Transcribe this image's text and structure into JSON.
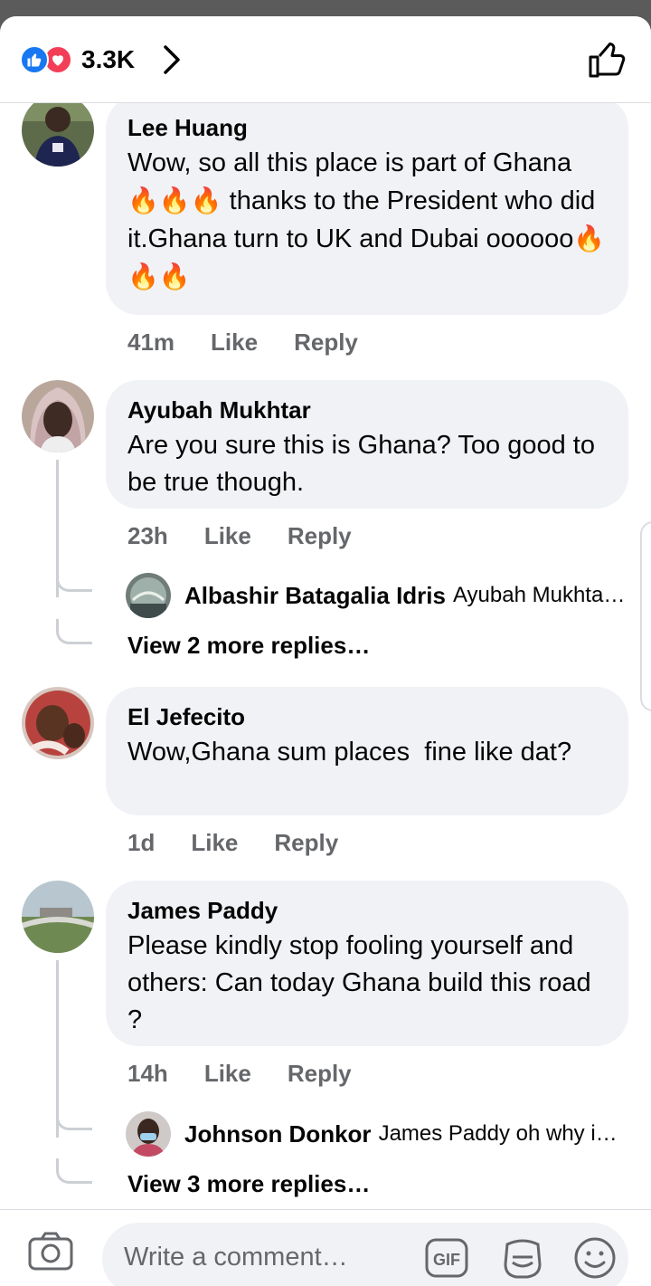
{
  "header": {
    "reaction_count": "3.3K"
  },
  "comments": [
    {
      "author": "Lee Huang",
      "text_before": "Wow, so all this place is part of Ghana ",
      "text_mid": " thanks to the President who did it.Ghana turn to UK and Dubai oooooo",
      "fire": "🔥🔥🔥",
      "time": "41m",
      "like": "Like",
      "reply": "Reply"
    },
    {
      "author": "Ayubah Mukhtar",
      "text": "Are you sure this is Ghana? Too good to be true though.",
      "time": "23h",
      "like": "Like",
      "reply": "Reply",
      "reply_preview": {
        "author": "Albashir Batagalia Idris",
        "snippet": "Ayubah Mukhtar…"
      },
      "view_more": "View 2 more replies…"
    },
    {
      "author": "El Jefecito",
      "text": "Wow,Ghana sum places  fine like dat?",
      "time": "1d",
      "like": "Like",
      "reply": "Reply"
    },
    {
      "author": "James Paddy",
      "text": "Please kindly stop fooling yourself and others: Can today Ghana build this road ?",
      "time": "14h",
      "like": "Like",
      "reply": "Reply",
      "reply_preview": {
        "author": "Johnson Donkor",
        "snippet": "James Paddy oh why i…"
      },
      "view_more": "View 3 more replies…"
    }
  ],
  "composer": {
    "placeholder": "Write a comment…",
    "gif_label": "GIF"
  },
  "colors": {
    "like_blue": "#1877f2",
    "love_red": "#f33e58",
    "bubble": "#f0f2f5",
    "meta_gray": "#65676b"
  }
}
